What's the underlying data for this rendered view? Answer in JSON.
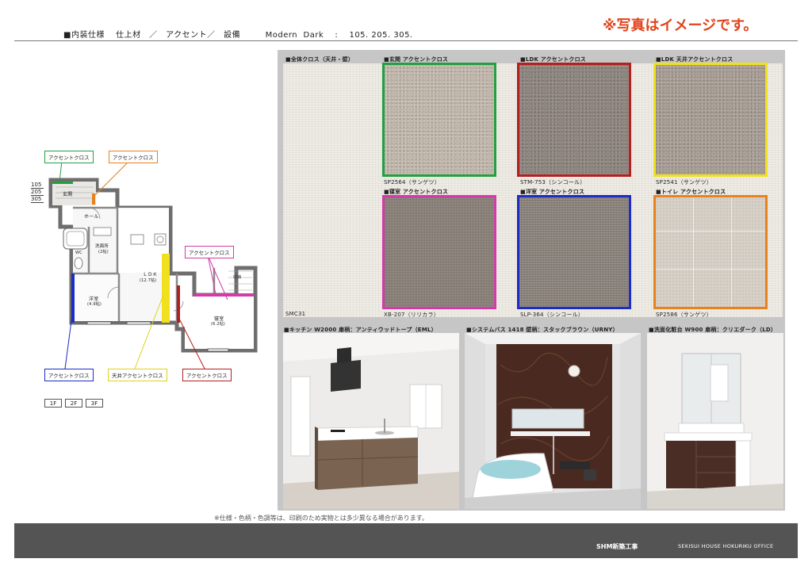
{
  "header": {
    "title": "■内装仕様　 仕上材　／　アクセント／　設備　　　Modern  Dark　 :　 105. 205. 305.",
    "notice": "※写真はイメージです。"
  },
  "materials": {
    "base": {
      "heading": "■全体クロス（天井・壁）",
      "code": "SMC31"
    },
    "entrance": {
      "heading": "■玄関 アクセントクロス",
      "code": "SP2564（サンゲツ）"
    },
    "ldk": {
      "heading": "■LDK アクセントクロス",
      "code": "STM-753（シンコール）"
    },
    "ldk_ceiling": {
      "heading": "■LDK 天井アクセントクロス",
      "code": "SP2541（サンゲツ）"
    },
    "bedroom": {
      "heading": "■寝室 アクセントクロス",
      "code": "XB-207（リリカラ）"
    },
    "western": {
      "heading": "■洋室 アクセントクロス",
      "code": "SLP-364（シンコール）"
    },
    "toilet": {
      "heading": "■トイレ アクセントクロス",
      "code": "SP2586（サンゲツ）"
    }
  },
  "equipment": {
    "kitchen": "■キッチン W2000 扉柄：アンティウッドトープ（EML）",
    "bath": "■システムバス 1418 壁柄：スタックブラウン（URNY）",
    "vanity": "■洗面化粧台 W900 扉柄：クリエダーク（LD）"
  },
  "floorplan": {
    "callouts": {
      "entrance": "アクセントクロス",
      "toilet": "アクセントクロス",
      "bedroom": "アクセントクロス",
      "western": "アクセントクロス",
      "ldk_ceiling": "天井アクセントクロス",
      "ldk": "アクセントクロス"
    },
    "units": [
      "105",
      "205",
      "305"
    ],
    "rooms": {
      "genkan": "玄関",
      "hall": "ホール",
      "wash": "洗面所",
      "wash_area": "(2帖)",
      "ldk": "ＬＤＫ",
      "ldk_area": "(12.7帖)",
      "western": "洋室",
      "western_area": "(4.9帖)",
      "bedroom": "寝室",
      "bedroom_area": "(6.2帖)",
      "closet": "収納",
      "wc": "WC"
    },
    "floors": [
      "1F",
      "2F",
      "3F"
    ]
  },
  "footer": {
    "disclaimer": "※仕様・色柄・色調等は、印刷のため実物とは多少異なる場合があります。",
    "left": "SHM新築工事",
    "right": "SEKISUI HOUSE HOKURIKU OFFICE"
  },
  "colors": {
    "notice": "#e0441c",
    "entrance": "#22a040",
    "ldk": "#b41f1f",
    "ldk_ceiling": "#f0e01e",
    "bedroom": "#d43aa8",
    "western": "#1c2cc4",
    "toilet": "#e7821e",
    "footer": "#545454"
  }
}
